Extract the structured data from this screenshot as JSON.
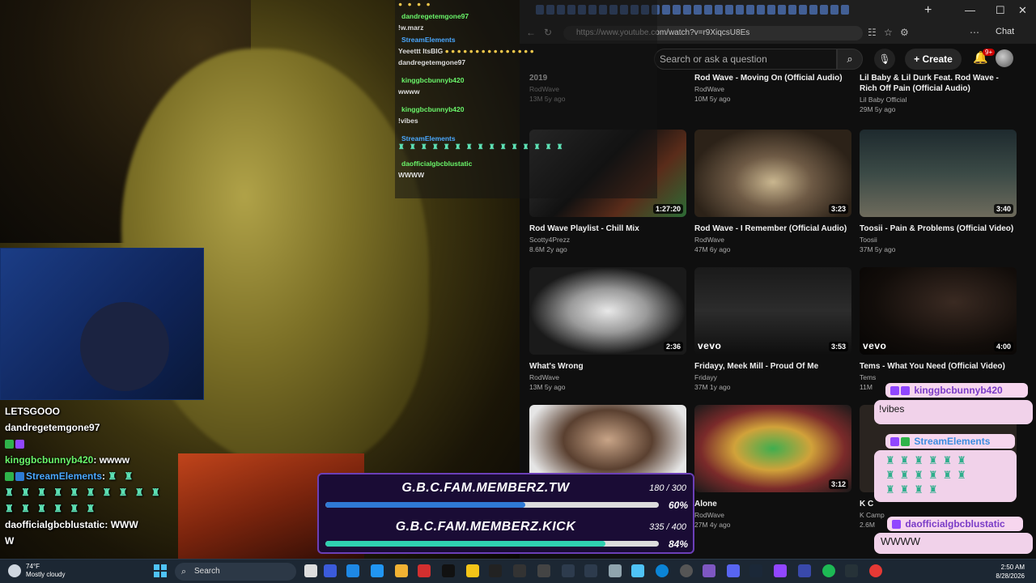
{
  "stream": {
    "chat_lines": [
      {
        "user": "LETSGOOO",
        "msg": "",
        "color": "white"
      },
      {
        "user": "dandregetemgone97",
        "msg": "",
        "color": "white"
      },
      {
        "user": "kinggbcbunnyb420",
        "msg": ": wwww",
        "color": "green"
      },
      {
        "user": "StreamElements",
        "msg": ":",
        "color": "blue"
      },
      {
        "user": "daofficialgbcblustatic",
        "msg": ": WWW",
        "color": "white"
      },
      {
        "user": "W",
        "msg": "",
        "color": "white"
      }
    ]
  },
  "top_chat": [
    {
      "name": "dandregetemgone97",
      "msg": "!w.marz"
    },
    {
      "name": "StreamElements",
      "msg": "Yeeettt ItsBIG"
    },
    {
      "name": "dandregetemgone97",
      "msg": ""
    },
    {
      "name": "kinggbcbunnyb420",
      "msg": "wwww"
    },
    {
      "name": "kinggbcbunnyb420",
      "msg": "!vibes"
    },
    {
      "name": "StreamElements",
      "msg": ""
    },
    {
      "name": "daofficialgbcblustatic",
      "msg": "WWWW"
    }
  ],
  "browser": {
    "url": "https://www.youtube.com/watch?v=r9XiqcsU8Es",
    "chat_label": "Chat",
    "search_placeholder": "Search or ask a question",
    "create_label": "Create",
    "notif_count": "9+"
  },
  "videos_row0": [
    {
      "title": "2019",
      "channel": "RodWave",
      "meta": "13M  5y ago"
    },
    {
      "title": "Rod Wave - Moving On (Official Audio)",
      "channel": "RodWave",
      "meta": "10M  5y ago"
    },
    {
      "title": "Lil Baby & Lil Durk Feat. Rod Wave - Rich Off Pain (Official Audio)",
      "channel": "Lil Baby Official",
      "meta": "29M  5y ago"
    }
  ],
  "videos": [
    {
      "title": "Rod Wave Playlist - Chill Mix",
      "channel": "Scotty4Prezz",
      "meta": "8.6M  2y ago",
      "duration": "1:27:20"
    },
    {
      "title": "Rod Wave - I Remember (Official Audio)",
      "channel": "RodWave",
      "meta": "47M  6y ago",
      "duration": "3:23"
    },
    {
      "title": "Toosii - Pain & Problems (Official Video)",
      "channel": "Toosii",
      "meta": "37M  5y ago",
      "duration": "3:40"
    },
    {
      "title": "What's Wrong",
      "channel": "RodWave",
      "meta": "13M  5y ago",
      "duration": "2:36"
    },
    {
      "title": "Fridayy, Meek Mill - Proud Of Me",
      "channel": "Fridayy",
      "meta": "37M  1y ago",
      "duration": "3:53"
    },
    {
      "title": "Tems - What You Need (Official Video)",
      "channel": "Tems",
      "meta": "11M",
      "duration": "4:00"
    },
    {
      "title": "",
      "channel": "",
      "meta": "",
      "duration": ""
    },
    {
      "title": "Alone",
      "channel": "RodWave",
      "meta": "27M  4y ago",
      "duration": "3:12"
    },
    {
      "title": "K C",
      "channel": "K Camp",
      "meta": "2.6M",
      "duration": ""
    }
  ],
  "goals": [
    {
      "title": "G.B.C.FAM.MEMBERZ.TW",
      "count": "180 / 300",
      "pct": "60%",
      "fill": 0.6,
      "color": "#2f7ad6"
    },
    {
      "title": "G.B.C.FAM.MEMBERZ.KICK",
      "count": "335 / 400",
      "pct": "84%",
      "fill": 0.84,
      "color": "#2fd0b0"
    }
  ],
  "right_chat": [
    {
      "name": "kinggbcbunnyb420",
      "msg": "!vibes"
    },
    {
      "name": "StreamElements",
      "msg": ""
    },
    {
      "name": "daofficialgbcblustatic",
      "msg": "WWWW"
    }
  ],
  "taskbar": {
    "temp": "74°F",
    "weather": "Mostly cloudy",
    "search": "Search",
    "time": "2:50 AM",
    "date": "8/28/2026"
  },
  "colors": {
    "goal_border": "#6b3fb8",
    "yt_bg": "#0f0f0f"
  }
}
